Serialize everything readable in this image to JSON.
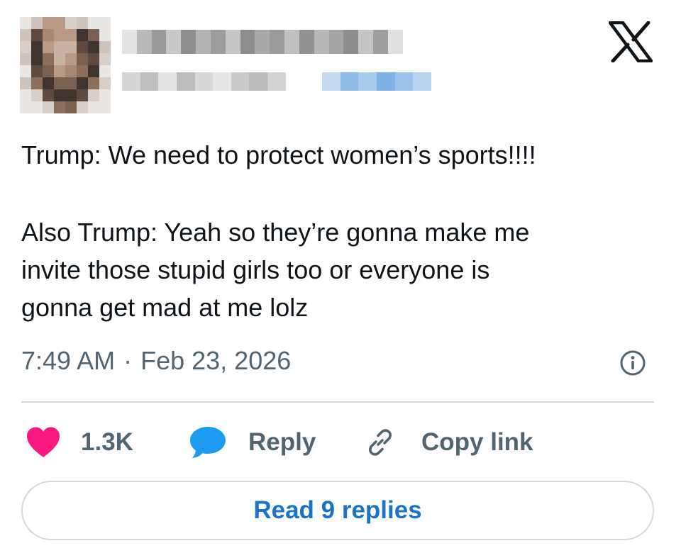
{
  "header": {
    "avatar_icon": "blurred-avatar",
    "close_icon": "x-logo-icon"
  },
  "tweet": {
    "line1": "Trump: We need to protect women’s sports!!!!",
    "line2": "Also Trump: Yeah so they’re gonna make me",
    "line3": "invite those stupid girls too or everyone is",
    "line4": "gonna get mad at me lolz"
  },
  "meta": {
    "time": "7:49 AM",
    "separator": "·",
    "date": "Feb 23, 2026",
    "info_icon": "info-icon"
  },
  "actions": {
    "likes": "1.3K",
    "reply_label": "Reply",
    "copy_label": "Copy link",
    "like_icon": "heart-icon",
    "reply_icon": "speech-bubble-icon",
    "copy_icon": "link-icon"
  },
  "read_replies_label": "Read 9 replies",
  "colors": {
    "like": "#f91880",
    "reply": "#1d9bf0",
    "link_text": "#1d74c6",
    "muted": "#536471",
    "divider": "#cfd9de"
  }
}
